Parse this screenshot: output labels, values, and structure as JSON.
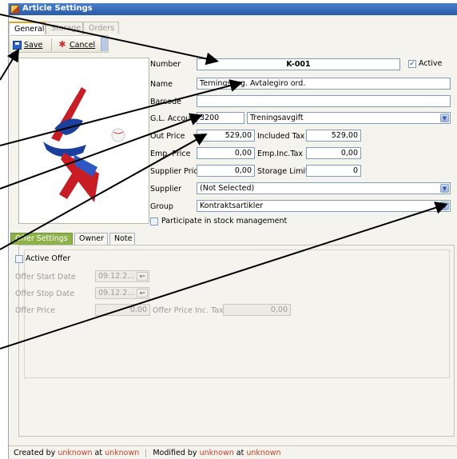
{
  "window": {
    "title": "Article Settings"
  },
  "top_tabs": [
    {
      "label": "General"
    },
    {
      "label": "Storage"
    },
    {
      "label": "Orders"
    }
  ],
  "toolbar": {
    "save_label": "Save",
    "cancel_label": "Cancel"
  },
  "fields": {
    "number_label": "Number",
    "number_value": "K-001",
    "active_label": "Active",
    "active_checked": true,
    "name_label": "Name",
    "name_value": "Terningsavg. Avtalegiro ord.",
    "barcode_label": "Barcode",
    "barcode_value": "",
    "gl_label": "G.L. Account",
    "gl_code": "3200",
    "gl_name": "Treningsavgift",
    "out_price_label": "Out Price",
    "out_price_value": "529,00",
    "included_tax_label": "Included Tax",
    "included_tax_value": "529,00",
    "emp_price_label": "Emp. Price",
    "emp_price_value": "0,00",
    "emp_inc_tax_label": "Emp.Inc.Tax",
    "emp_inc_tax_value": "0,00",
    "supplier_price_label": "Supplier Price",
    "supplier_price_value": "0,00",
    "storage_limit_label": "Storage Limit",
    "storage_limit_value": "0",
    "supplier_label": "Supplier",
    "supplier_value": "(Not Selected)",
    "group_label": "Group",
    "group_value": "Kontraktsartikler",
    "stock_label": "Participate in stock management"
  },
  "sub_tabs": [
    {
      "label": "Offer Settings"
    },
    {
      "label": "Owner"
    },
    {
      "label": "Note"
    }
  ],
  "offer": {
    "active_label": "Active Offer",
    "start_label": "Offer Start Date",
    "start_value": "09.12.2...",
    "stop_label": "Offer Stop Date",
    "stop_value": "09.12.2...",
    "price_label": "Offer Price",
    "price_value": "0,00",
    "price_inc_label": "Offer Price Inc. Tax",
    "price_inc_value": "0,00"
  },
  "status": {
    "created_by": "Created by",
    "created_user": "unknown",
    "at1": "at",
    "created_at": "unknown",
    "modified_by": "Modified by",
    "modified_user": "unknown",
    "at2": "at",
    "modified_at": "unknown"
  },
  "colors": {
    "accent": "#2a5aa8",
    "tab_green": "#8fb24b",
    "status_user": "#c8402a"
  },
  "icons": {
    "save": "save-icon",
    "cancel": "cancel-icon",
    "dropdown": "chevron-down-icon"
  }
}
